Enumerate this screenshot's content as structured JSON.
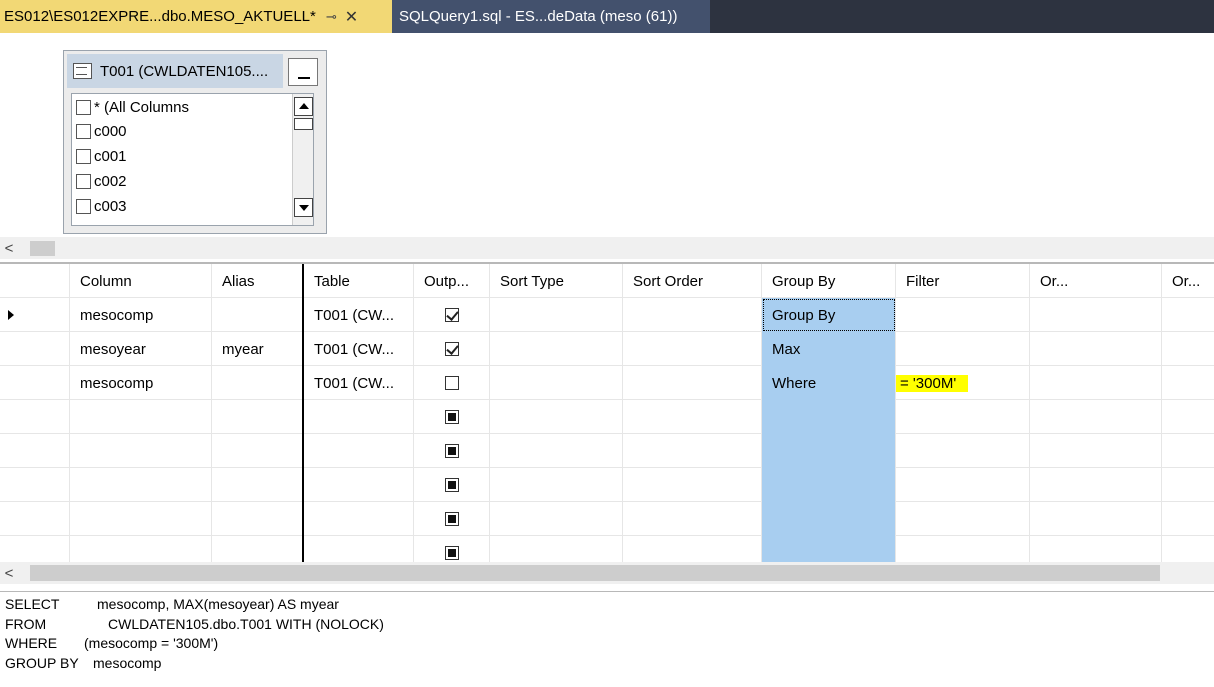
{
  "tabs": {
    "active": {
      "label": "ES012\\ES012EXPRE...dbo.MESO_AKTUELL*",
      "pin": "⊸",
      "close": "✕"
    },
    "second": {
      "label": "SQLQuery1.sql - ES...deData (meso (61))"
    }
  },
  "diagram": {
    "table_title": "T001 (CWLDATEN105....",
    "columns": [
      "* (All Columns",
      "c000",
      "c001",
      "c002",
      "c003"
    ],
    "scroll_left": "<"
  },
  "grid": {
    "headers": [
      "Column",
      "Alias",
      "Table",
      "Outp...",
      "Sort Type",
      "Sort Order",
      "Group By",
      "Filter",
      "Or...",
      "Or..."
    ],
    "rows": [
      {
        "column": "mesocomp",
        "alias": "",
        "table": "T001 (CW...",
        "output": "checked",
        "group_by": "Group By",
        "filter": ""
      },
      {
        "column": "mesoyear",
        "alias": "myear",
        "table": "T001 (CW...",
        "output": "checked",
        "group_by": "Max",
        "filter": ""
      },
      {
        "column": "mesocomp",
        "alias": "",
        "table": "T001 (CW...",
        "output": "unchecked",
        "group_by": "Where",
        "filter": "= '300M'"
      }
    ],
    "empty_rows": 5,
    "scroll_left": "<"
  },
  "sql": {
    "lines": [
      {
        "kw": "SELECT",
        "text": "mesocomp, MAX(mesoyear) AS myear"
      },
      {
        "kw": "FROM",
        "text": "CWLDATEN105.dbo.T001 WITH (NOLOCK)"
      },
      {
        "kw": "WHERE",
        "text": "(mesocomp = '300M')"
      },
      {
        "kw": "GROUP BY",
        "text": "mesocomp"
      }
    ]
  },
  "colors": {
    "tab_active": "#f2d875",
    "tab_inactive": "#43516d",
    "group_by_col": "#a8cef0",
    "highlight": "#ffff00"
  }
}
